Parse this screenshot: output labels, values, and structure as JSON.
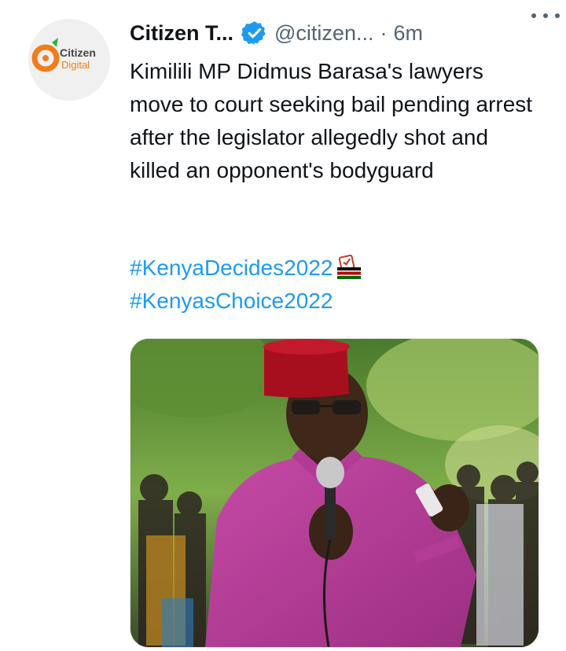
{
  "tweet": {
    "avatar_logo_line1": "Citizen",
    "avatar_logo_line2": "Digital",
    "display_name": "Citizen T...",
    "handle": "@citizen...",
    "separator": "·",
    "time": "6m",
    "text": "Kimilili MP Didmus Barasa's lawyers move to court seeking bail pending arrest after the legislator allegedly shot and killed an opponent's bodyguard",
    "hashtags": [
      "#KenyaDecides2022",
      "#KenyasChoice2022"
    ]
  },
  "colors": {
    "link": "#1d9bf0",
    "verified": "#1d9bf0",
    "text": "#0f1419",
    "secondary": "#536471"
  },
  "icons": {
    "verified": "verified-badge-icon",
    "more": "more-options-icon",
    "ballot": "ballot-box-icon"
  },
  "media": {
    "type": "photo"
  }
}
